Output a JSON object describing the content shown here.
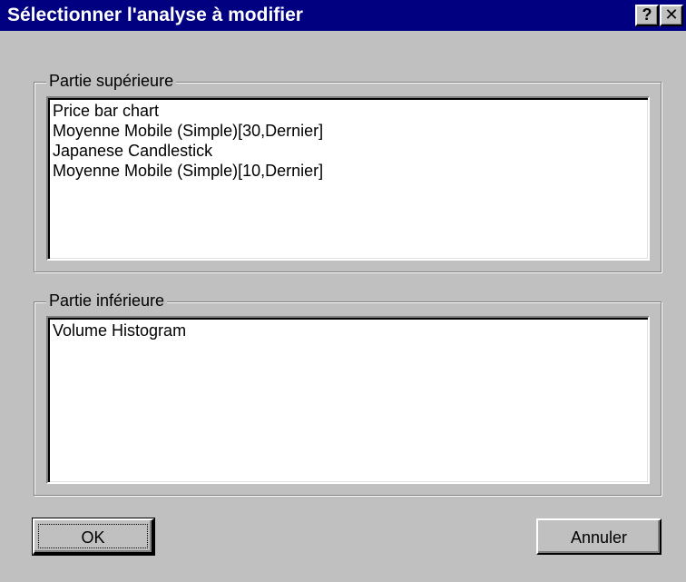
{
  "window": {
    "title": "Sélectionner l'analyse à modifier",
    "help_glyph": "?",
    "close_glyph": "✕"
  },
  "upper_section": {
    "label": "Partie supérieure",
    "items": [
      "Price bar chart",
      "Moyenne Mobile (Simple)[30,Dernier]",
      "Japanese Candlestick",
      "Moyenne Mobile (Simple)[10,Dernier]"
    ]
  },
  "lower_section": {
    "label": "Partie inférieure",
    "items": [
      "Volume Histogram"
    ]
  },
  "buttons": {
    "ok_label": "OK",
    "cancel_label": "Annuler"
  },
  "colors": {
    "titlebar": "#000080",
    "face": "#c0c0c0",
    "list_background": "#ffffff"
  },
  "icons": {
    "help": "help-icon",
    "close": "close-icon"
  }
}
